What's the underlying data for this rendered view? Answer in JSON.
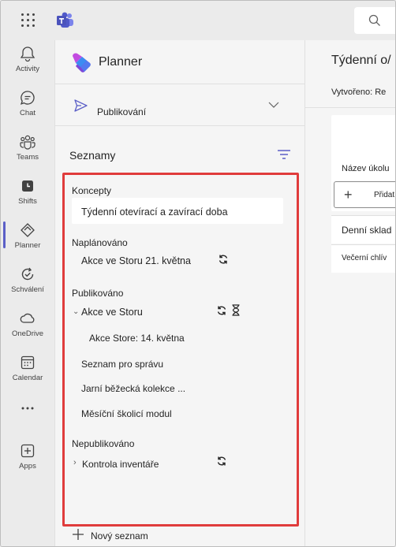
{
  "app": {
    "name": "Microsoft Teams"
  },
  "rail": {
    "items": [
      {
        "label": "Activity",
        "icon": "bell-icon"
      },
      {
        "label": "Chat",
        "icon": "chat-icon"
      },
      {
        "label": "Teams",
        "icon": "teams-icon"
      },
      {
        "label": "Shifts",
        "icon": "shifts-icon"
      },
      {
        "label": "Planner",
        "icon": "planner-icon",
        "active": true
      },
      {
        "label": "Schválení",
        "icon": "approvals-icon"
      },
      {
        "label": "OneDrive",
        "icon": "cloud-icon"
      },
      {
        "label": "Calendar",
        "icon": "calendar-icon"
      },
      {
        "label": "",
        "icon": "more-icon"
      },
      {
        "label": "Apps",
        "icon": "apps-icon"
      }
    ]
  },
  "panel": {
    "title": "Planner",
    "publish_label": "Publikování",
    "lists_title": "Seznamy",
    "sections": {
      "drafts": {
        "label": "Koncepty",
        "items": [
          "Týdenní otevírací a zavírací doba"
        ]
      },
      "scheduled": {
        "label": "Naplánováno",
        "items": [
          "Akce ve Storu 21. května"
        ]
      },
      "published": {
        "label": "Publikováno",
        "group": "Akce ve Storu",
        "children": [
          "Akce Store: 14. května"
        ],
        "items": [
          "Seznam pro správu",
          "Jarní běžecká kolekce ...",
          "Měsíční školicí modul"
        ]
      },
      "unpublished": {
        "label": "Nepublikováno",
        "items": [
          "Kontrola inventáře"
        ]
      }
    },
    "new_list_label": "Nový seznam"
  },
  "right": {
    "title": "Týdenní o/",
    "meta": "Vytvořeno:  Re",
    "task_column_header": "Název úkolu",
    "add_label": "Přidat",
    "tasks": [
      "Denní sklad",
      "Večerní chlív"
    ]
  },
  "colors": {
    "accent": "#5b5fc7",
    "highlight_box": "#e03c3c"
  }
}
